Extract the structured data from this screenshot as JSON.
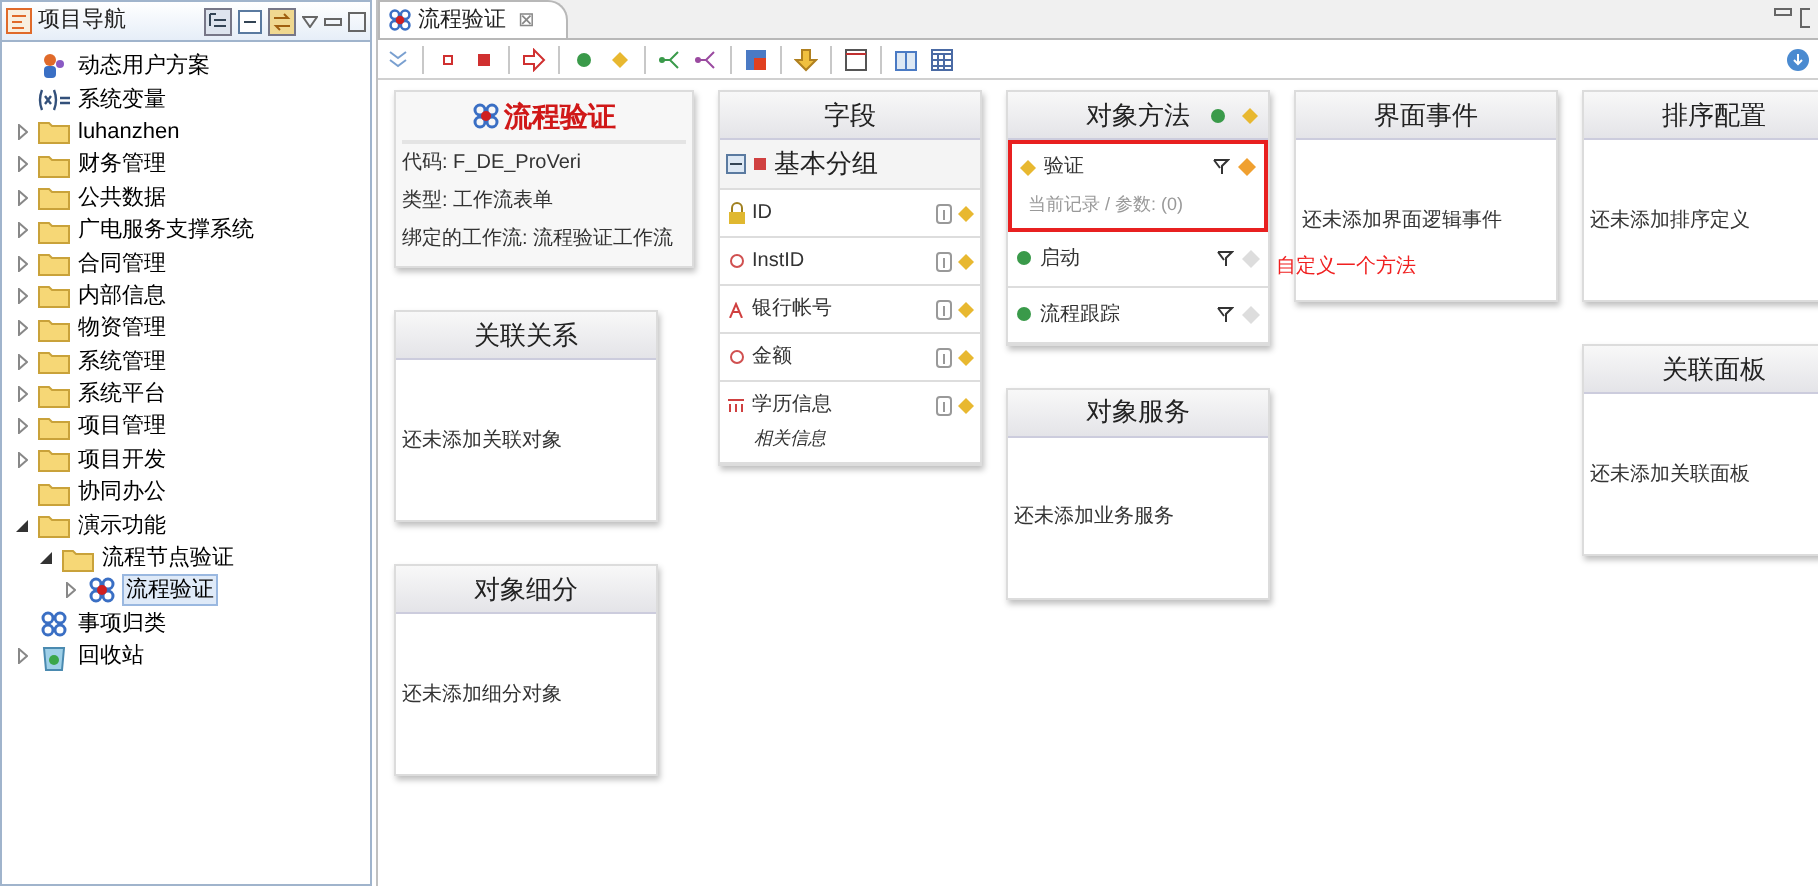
{
  "navigator": {
    "title": "项目导航",
    "tree": [
      {
        "label": "动态用户方案",
        "kind": "scheme",
        "selected": false
      },
      {
        "label": "系统变量",
        "kind": "variable",
        "selected": false
      },
      {
        "label": "luhanzhen",
        "kind": "folder",
        "expanded": false,
        "selected": false
      },
      {
        "label": "财务管理",
        "kind": "folder",
        "expanded": false,
        "selected": false
      },
      {
        "label": "公共数据",
        "kind": "folder",
        "expanded": false,
        "selected": false
      },
      {
        "label": "广电服务支撑系统",
        "kind": "folder",
        "expanded": false,
        "selected": false
      },
      {
        "label": "合同管理",
        "kind": "folder",
        "expanded": false,
        "selected": false
      },
      {
        "label": "内部信息",
        "kind": "folder",
        "expanded": false,
        "selected": false
      },
      {
        "label": "物资管理",
        "kind": "folder",
        "expanded": false,
        "selected": false
      },
      {
        "label": "系统管理",
        "kind": "folder",
        "expanded": false,
        "selected": false
      },
      {
        "label": "系统平台",
        "kind": "folder",
        "expanded": false,
        "selected": false
      },
      {
        "label": "项目管理",
        "kind": "folder",
        "expanded": false,
        "selected": false
      },
      {
        "label": "项目开发",
        "kind": "folder",
        "expanded": false,
        "selected": false
      },
      {
        "label": "协同办公",
        "kind": "folder",
        "selected": false
      },
      {
        "label": "演示功能",
        "kind": "folder",
        "expanded": true,
        "selected": false,
        "children": [
          {
            "label": "流程节点验证",
            "kind": "folder",
            "expanded": true,
            "selected": false,
            "children": [
              {
                "label": "流程验证",
                "kind": "flow",
                "expanded": false,
                "selected": true
              }
            ]
          }
        ]
      },
      {
        "label": "事项归类",
        "kind": "category",
        "selected": false
      },
      {
        "label": "回收站",
        "kind": "recycle",
        "expanded": false,
        "selected": false
      }
    ]
  },
  "editor": {
    "tab": {
      "label": "流程验证",
      "close": "⊠"
    },
    "columns": [
      [
        {
          "kind": "info",
          "title": "流程验证",
          "lines": [
            "代码: F_DE_ProVeri",
            "类型: 工作流表单",
            "绑定的工作流:  流程验证工作流"
          ]
        },
        {
          "kind": "empty",
          "title": "关联关系",
          "text": "还未添加关联对象"
        },
        {
          "kind": "empty",
          "title": "对象细分",
          "text": "还未添加细分对象"
        }
      ],
      [
        {
          "kind": "fields",
          "title": "字段",
          "group": "基本分组",
          "fields": [
            {
              "label": "ID",
              "kind": "key"
            },
            {
              "label": "InstID",
              "kind": "plain"
            },
            {
              "label": "银行帐号",
              "kind": "text"
            },
            {
              "label": "金额",
              "kind": "plain"
            },
            {
              "label": "学历信息",
              "kind": "table",
              "sub": "相关信息"
            }
          ]
        }
      ],
      [
        {
          "kind": "methods",
          "title": "对象方法",
          "methods": [
            {
              "label": "验证",
              "kind": "custom",
              "highlighted": true,
              "sub": "当前记录 / 参数: (0)"
            },
            {
              "label": "启动",
              "kind": "system",
              "highlighted": false
            },
            {
              "label": "流程跟踪",
              "kind": "system",
              "highlighted": false
            }
          ],
          "note": "自定义一个方法"
        },
        {
          "kind": "empty",
          "title": "对象服务",
          "text": "还未添加业务服务"
        }
      ],
      [
        {
          "kind": "empty",
          "title": "界面事件",
          "text": "还未添加界面逻辑事件"
        }
      ],
      [
        {
          "kind": "empty",
          "title": "排序配置",
          "text": "还未添加排序定义"
        },
        {
          "kind": "empty",
          "title": "关联面板",
          "text": "还未添加关联面板"
        }
      ]
    ]
  }
}
